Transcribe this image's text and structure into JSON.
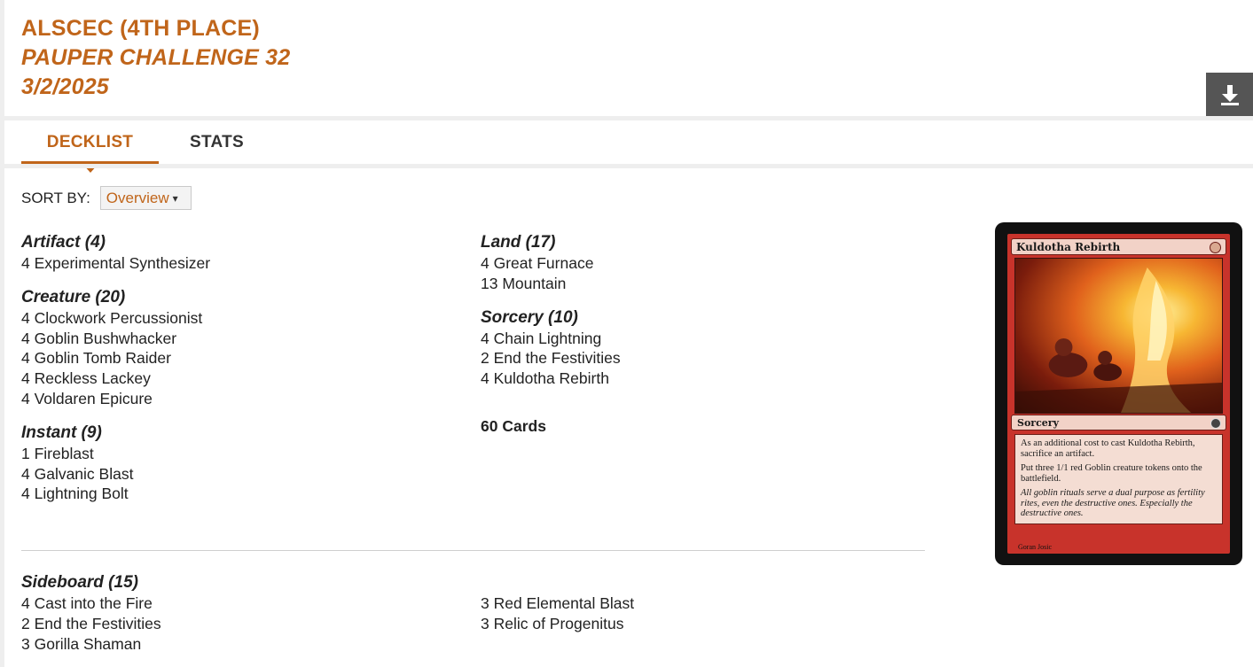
{
  "header": {
    "player": "ALSCEC (4TH PLACE)",
    "event": "PAUPER CHALLENGE 32",
    "date": "3/2/2025"
  },
  "download": {
    "icon": "download-icon"
  },
  "tabs": [
    {
      "label": "DECKLIST",
      "active": true
    },
    {
      "label": "STATS",
      "active": false
    }
  ],
  "sort": {
    "label": "SORT BY:",
    "selected": "Overview"
  },
  "maindeck": {
    "left": [
      {
        "heading": "Artifact (4)",
        "cards": [
          "4 Experimental Synthesizer"
        ]
      },
      {
        "heading": "Creature (20)",
        "cards": [
          "4 Clockwork Percussionist",
          "4 Goblin Bushwhacker",
          "4 Goblin Tomb Raider",
          "4 Reckless Lackey",
          "4 Voldaren Epicure"
        ]
      },
      {
        "heading": "Instant (9)",
        "cards": [
          "1 Fireblast",
          "4 Galvanic Blast",
          "4 Lightning Bolt"
        ]
      }
    ],
    "right": [
      {
        "heading": "Land (17)",
        "cards": [
          "4 Great Furnace",
          "13 Mountain"
        ]
      },
      {
        "heading": "Sorcery (10)",
        "cards": [
          "4 Chain Lightning",
          "2 End the Festivities",
          "4 Kuldotha Rebirth"
        ]
      }
    ],
    "total": "60 Cards"
  },
  "sideboard": {
    "heading": "Sideboard (15)",
    "left": [
      "4 Cast into the Fire",
      "2 End the Festivities",
      "3 Gorilla Shaman"
    ],
    "right": [
      "3 Red Elemental Blast",
      "3 Relic of Progenitus"
    ]
  },
  "card_preview": {
    "name": "Kuldotha Rebirth",
    "type": "Sorcery",
    "rules": [
      "As an additional cost to cast Kuldotha Rebirth, sacrifice an artifact.",
      "Put three 1/1 red Goblin creature tokens onto the battlefield."
    ],
    "flavor": "All goblin rituals serve a dual purpose as fertility rites, even the destructive ones. Especially the destructive ones.",
    "artist": "Goran Josic",
    "frame_color": "#c8332b"
  },
  "colors": {
    "accent": "#c0651a",
    "button_bg": "#555555"
  }
}
